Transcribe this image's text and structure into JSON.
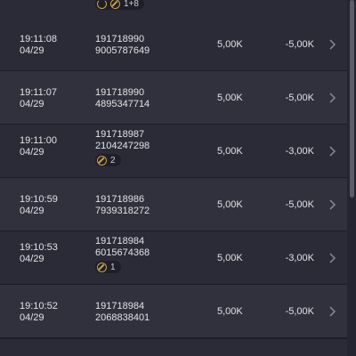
{
  "top_row": {
    "badge_count": "1+8"
  },
  "rows": [
    {
      "time": "19:11:08",
      "date": "04/29",
      "id_line1": "191718990",
      "id_line2": "9005787649",
      "amount": "5,00K",
      "result": "-5,00K",
      "badge": null
    },
    {
      "time": "19:11:07",
      "date": "04/29",
      "id_line1": "191718990",
      "id_line2": "4895347714",
      "amount": "5,00K",
      "result": "-5,00K",
      "badge": null
    },
    {
      "time": "19:11:00",
      "date": "04/29",
      "id_line1": "191718987",
      "id_line2": "2104247298",
      "amount": "5,00K",
      "result": "-3,00K",
      "badge": "2"
    },
    {
      "time": "19:10:59",
      "date": "04/29",
      "id_line1": "191718986",
      "id_line2": "7939318272",
      "amount": "5,00K",
      "result": "-5,00K",
      "badge": null
    },
    {
      "time": "19:10:53",
      "date": "04/29",
      "id_line1": "191718984",
      "id_line2": "6015674368",
      "amount": "5,00K",
      "result": "-3,00K",
      "badge": "1"
    },
    {
      "time": "19:10:52",
      "date": "04/29",
      "id_line1": "191718984",
      "id_line2": "2068838401",
      "amount": "5,00K",
      "result": "-5,00K",
      "badge": null
    }
  ],
  "icons": {
    "chevron": "chevron-right-icon",
    "coin": "coin-icon",
    "refresh": "refresh-icon"
  },
  "colors": {
    "background": "#242530",
    "row_odd": "#2a2b37",
    "row_even": "#30313d",
    "accent_gold": "#c9a24a"
  }
}
